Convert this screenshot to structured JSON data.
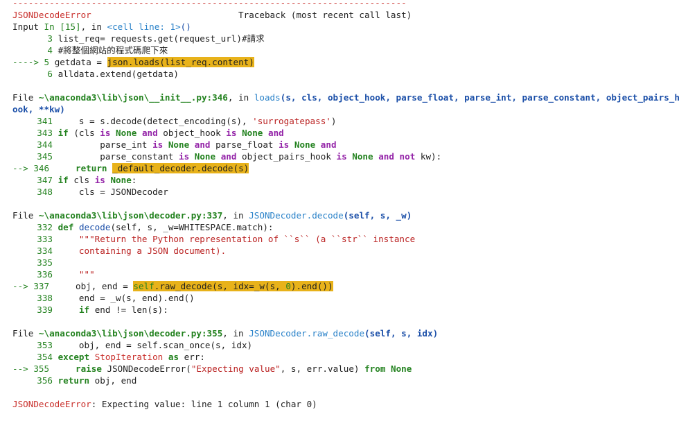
{
  "separator": "---------------------------------------------------------------------------",
  "header": {
    "error_name": "JSONDecodeError",
    "traceback_label": "Traceback (most recent call last)"
  },
  "input": {
    "prefix": "Input ",
    "in_label": "In [15]",
    "mid": ", in ",
    "cell_label": "<cell line: 1>",
    "parens": "()",
    "lines": [
      {
        "num": "3",
        "code": "list_req= requests.get(request_url)#請求"
      },
      {
        "num": "4",
        "code": "#將整個網站的程式碼爬下來"
      },
      {
        "arrow": "---->",
        "num": "5",
        "pre": "getdata = ",
        "hl": "json.loads(list_req.content)"
      },
      {
        "num": "6",
        "code": "alldata.extend(getdata)"
      }
    ]
  },
  "frame1": {
    "file_prefix": "File ",
    "path": "~\\anaconda3\\lib\\json\\__init__.py:346",
    "in_word": ", in ",
    "func": "loads",
    "args_line1": "(s, cls, object_hook, parse_float, parse_int, parse_constant, object_pairs_h",
    "args_line2": "ook, **kw)",
    "l341_num": "341",
    "l341_a": "    s = s.decode(detect_encoding(s), ",
    "l341_str": "'surrogatepass'",
    "l341_b": ")",
    "l343_num": "343",
    "l344_num": "344",
    "l345_num": "345",
    "arrow": "-->",
    "l346_num": "346",
    "l346_kw": "return",
    "l346_hl": "_default_decoder.decode(s)",
    "l347_num": "347",
    "l348_num": "348",
    "l348_code": "    cls = JSONDecoder"
  },
  "frame2": {
    "file_prefix": "File ",
    "path": "~\\anaconda3\\lib\\json\\decoder.py:337",
    "in_word": ", in ",
    "func": "JSONDecoder.decode",
    "args": "(self, s, _w)",
    "l332_num": "332",
    "l332_kw": "def",
    "l332_fn": "decode",
    "l332_rest": "(self, s, _w=WHITESPACE.match):",
    "l333_num": "333",
    "l333_str": "    \"\"\"Return the Python representation of ``s`` (a ``str`` instance",
    "l334_num": "334",
    "l334_str": "    containing a JSON document).",
    "l335_num": "335",
    "l336_num": "336",
    "l336_str": "    \"\"\"",
    "arrow": "-->",
    "l337_num": "337",
    "l337_pre": "    obj, end = ",
    "l337_hl_self": "self",
    "l337_hl_rest": ".raw_decode(s, idx=_w(s, ",
    "l337_hl_zero": "0",
    "l337_hl_end": ").end())",
    "l338_num": "338",
    "l338_code": "    end = _w(s, end).end()",
    "l339_num": "339",
    "l339_pre": "    ",
    "l339_kw": "if",
    "l339_rest": " end != len(s):"
  },
  "frame3": {
    "file_prefix": "File ",
    "path": "~\\anaconda3\\lib\\json\\decoder.py:355",
    "in_word": ", in ",
    "func": "JSONDecoder.raw_decode",
    "args": "(self, s, idx)",
    "l353_num": "353",
    "l353_code": "    obj, end = self.scan_once(s, idx)",
    "l354_num": "354",
    "l354_kw": "except",
    "l354_exc": "StopIteration",
    "l354_as": "as",
    "l354_rest": " err:",
    "arrow": "-->",
    "l355_num": "355",
    "l355_kw": "raise",
    "l355_a": " JSONDecodeError(",
    "l355_str": "\"Expecting value\"",
    "l355_b": ", s, err.value) ",
    "l355_from": "from",
    "l355_none": "None",
    "l356_num": "356",
    "l356_kw": "return",
    "l356_rest": " obj, end"
  },
  "final": {
    "error_name": "JSONDecodeError",
    "message": ": Expecting value: line 1 column 1 (char 0)"
  }
}
